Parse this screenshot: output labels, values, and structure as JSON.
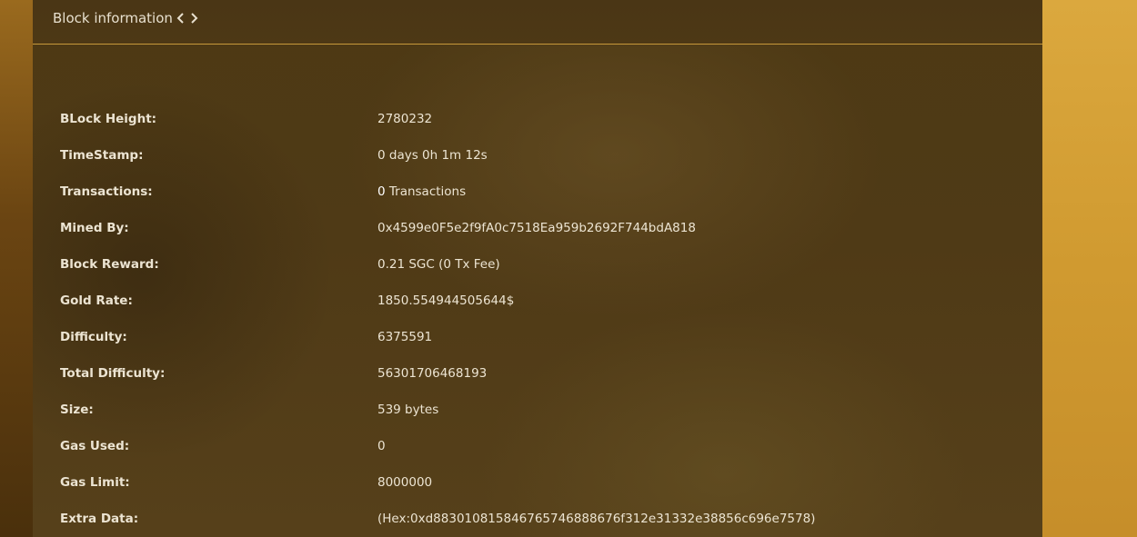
{
  "header": {
    "title": "Block information",
    "prev_icon": "chevron-left-icon",
    "next_icon": "chevron-right-icon"
  },
  "colors": {
    "accent_line": "#c7983a",
    "text": "#ece4d2",
    "panel_bg": "#4d3914",
    "page_right_bg": "#d09a30"
  },
  "block": {
    "height": {
      "label": "BLock Height:",
      "value": "2780232"
    },
    "timestamp": {
      "label": "TimeStamp:",
      "value": "0 days 0h 1m 12s"
    },
    "transactions": {
      "label": "Transactions:",
      "count": "0",
      "suffix": " Transactions"
    },
    "mined_by": {
      "label": "Mined By:",
      "value": "0x4599e0F5e2f9fA0c7518Ea959b2692F744bdA818"
    },
    "block_reward": {
      "label": "Block Reward:",
      "value": "0.21 SGC (0 Tx Fee)"
    },
    "gold_rate": {
      "label": "Gold Rate:",
      "value": "1850.554944505644$"
    },
    "difficulty": {
      "label": "Difficulty:",
      "value": "6375591"
    },
    "total_difficulty": {
      "label": "Total Difficulty:",
      "value": "56301706468193"
    },
    "size": {
      "label": "Size:",
      "value": "539 bytes"
    },
    "gas_used": {
      "label": "Gas Used:",
      "value": "0"
    },
    "gas_limit": {
      "label": "Gas Limit:",
      "value": "8000000"
    },
    "extra_data": {
      "label": "Extra Data:",
      "value": "(Hex:0xd883010815846765746888676f312e31332e38856c696e7578)"
    }
  }
}
